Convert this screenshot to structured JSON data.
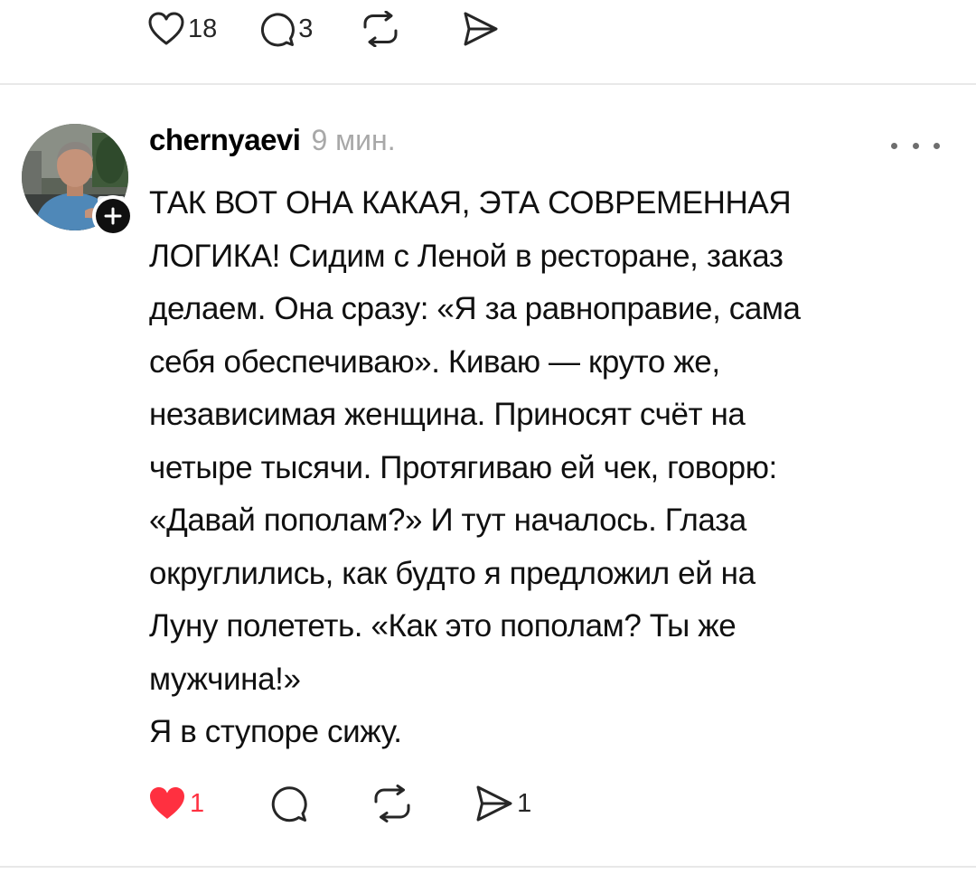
{
  "previous_post": {
    "actions": {
      "likes": "18",
      "replies": "3"
    }
  },
  "post": {
    "username": "chernyaevi",
    "timestamp": "9 мин.",
    "text": "ТАК ВОТ ОНА КАКАЯ, ЭТА СОВРЕМЕННАЯ\nЛОГИКА! Сидим с Леной в ресторане, заказ\nделаем. Она сразу: «Я за равноправие, сама\nсебя обеспечиваю». Киваю — круто же,\nнезависимая женщина. Приносят счёт на\nчетыре тысячи. Протягиваю ей чек, говорю:\n«Давай пополам?» И тут началось. Глаза\nокруглились, как будто я предложил ей на\nЛуну полететь. «Как это пополам? Ты же\nмужчина!»\nЯ в ступоре сижу.",
    "actions": {
      "likes": "1",
      "shares": "1",
      "liked": true
    }
  },
  "icons": {
    "like": "heart-icon",
    "reply": "comment-icon",
    "repost": "repost-icon",
    "share": "send-icon",
    "more": "more-icon",
    "follow": "plus-icon"
  },
  "colors": {
    "liked": "#ff3040",
    "icon": "#262626",
    "muted": "#a8a8a8",
    "divider": "#e8e8e8"
  }
}
